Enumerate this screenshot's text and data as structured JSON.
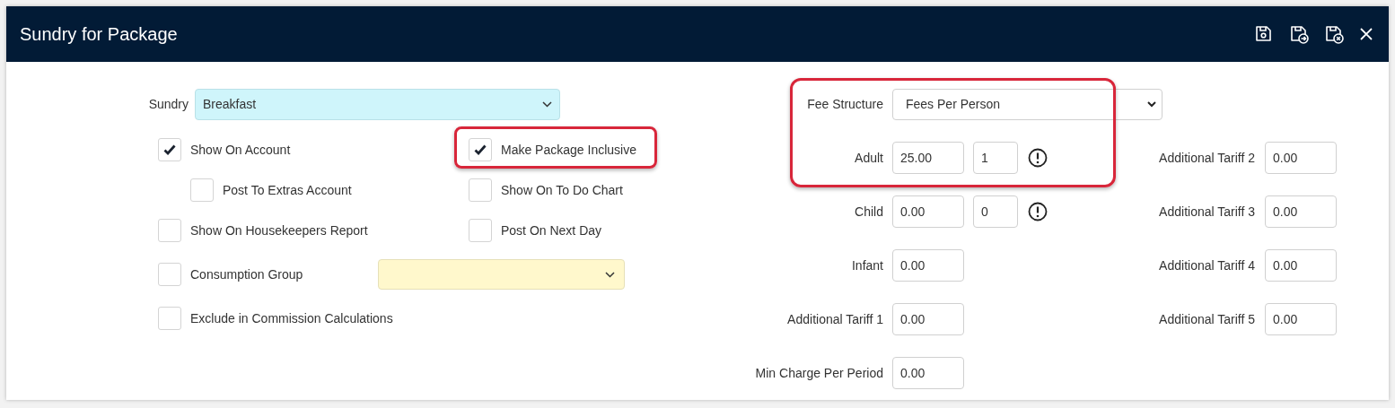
{
  "window": {
    "title": "Sundry for Package"
  },
  "sundry": {
    "label": "Sundry",
    "value": "Breakfast"
  },
  "option_columns": [
    [
      {
        "label": "Show On Account",
        "checked": true,
        "children": [
          {
            "label": "Post To Extras Account",
            "checked": false
          }
        ]
      },
      {
        "label": "Show On Housekeepers Report",
        "checked": false
      }
    ],
    [
      {
        "label": "Make Package Inclusive",
        "checked": true
      },
      {
        "label": "Show On To Do Chart",
        "checked": false
      },
      {
        "label": "Post On Next Day",
        "checked": false
      }
    ]
  ],
  "consumption_group": {
    "label": "Consumption Group",
    "checked": false
  },
  "exclude_option": {
    "label": "Exclude in Commission Calculations",
    "checked": false
  },
  "fee_structure": {
    "label": "Fee Structure",
    "value": "Fees Per Person"
  },
  "rates": [
    {
      "label": "Adult",
      "value": "25.00",
      "count": "1",
      "warning": true
    },
    {
      "label": "Child",
      "value": "0.00",
      "count": "0",
      "warning": true
    },
    {
      "label": "Infant",
      "value": "0.00",
      "warning": false
    },
    {
      "label": "Additional Tariff 1",
      "value": "0.00",
      "warning": false
    },
    {
      "label": "Min Charge Per Period",
      "value": "0.00",
      "warning": false
    }
  ],
  "extra_tariffs": [
    {
      "label": "Additional Tariff 2",
      "value": "0.00"
    },
    {
      "label": "Additional Tariff 3",
      "value": "0.00"
    },
    {
      "label": "Additional Tariff 4",
      "value": "0.00"
    },
    {
      "label": "Additional Tariff 5",
      "value": "0.00"
    }
  ]
}
